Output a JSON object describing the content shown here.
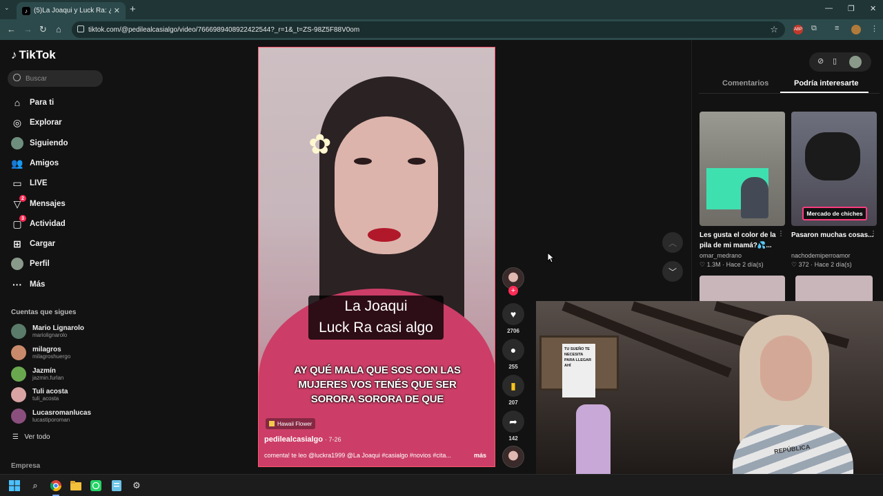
{
  "browser": {
    "tab_title": "(5)La Joaqui y Luck Ra: ¿qué pa",
    "tab_close": "✕",
    "new_tab": "+",
    "url": "tiktok.com/@pedilealcasialgo/video/7666989408922422544?_r=1&_t=ZS-98Z5F88V0om"
  },
  "sidebar": {
    "logo": "TikTok",
    "search_placeholder": "Buscar",
    "nav": [
      {
        "label": "Para ti",
        "icon": "home-icon"
      },
      {
        "label": "Explorar",
        "icon": "compass-icon"
      },
      {
        "label": "Siguiendo",
        "icon": "following-avatar-icon"
      },
      {
        "label": "Amigos",
        "icon": "friends-icon"
      },
      {
        "label": "LIVE",
        "icon": "live-icon"
      },
      {
        "label": "Mensajes",
        "icon": "messages-icon",
        "badge": "2"
      },
      {
        "label": "Actividad",
        "icon": "activity-icon",
        "badge": "3"
      },
      {
        "label": "Cargar",
        "icon": "upload-icon"
      },
      {
        "label": "Perfil",
        "icon": "profile-icon"
      },
      {
        "label": "Más",
        "icon": "more-icon"
      }
    ],
    "following_title": "Cuentas que sigues",
    "following": [
      {
        "name": "Mario Lignarolo",
        "user": "mariolignarolo",
        "color": "#5a7a6a"
      },
      {
        "name": "milagros",
        "user": "milagroshuergo",
        "color": "#c98a6b"
      },
      {
        "name": "Jazmín",
        "user": "jazmin.furlan",
        "color": "#6aa84f"
      },
      {
        "name": "Tuli acosta",
        "user": "tuli_acosta",
        "color": "#d9a3a3"
      },
      {
        "name": "Lucasromanlucas",
        "user": "lucastiporoman",
        "color": "#8a4f7d"
      }
    ],
    "see_all": "Ver todo",
    "company": "Empresa"
  },
  "video": {
    "caption_line1": "La Joaqui",
    "caption_line2": "Luck Ra casi algo",
    "subtitle": "AY QUÉ MALA QUE SOS CON LAS MUJERES VOS TENÉS QUE SER SORORA SORORA DE QUE",
    "music": "Hawaii Flower",
    "author": "pedilealcasialgo",
    "date": "· 7-26",
    "description": "comenta! te leo @luckra1999 @La Joaqui #casialgo #novios #cita...",
    "more": "más"
  },
  "actions": {
    "likes": "2706",
    "comments": "255",
    "saves": "207",
    "shares": "142"
  },
  "right_panel": {
    "tab_comments": "Comentarios",
    "tab_suggested": "Podría interesarte",
    "cards": [
      {
        "title": "Les gusta el color de la pila de mi mamá?💦...",
        "author": "omar_medrano",
        "stats": "♡ 1.3M · Hace 2 día(s)"
      },
      {
        "title": "Pasaron muchas cosas...",
        "author": "nachodemiperroamor",
        "stats": "♡ 372 · Hace 2 día(s)",
        "label": "Mercado de chiches"
      }
    ]
  },
  "webcam": {
    "poster_text": "TU SUEÑO TE NECESITA PARA LLEGAR AHÍ",
    "shirt_text": "REPÚBLICA"
  }
}
